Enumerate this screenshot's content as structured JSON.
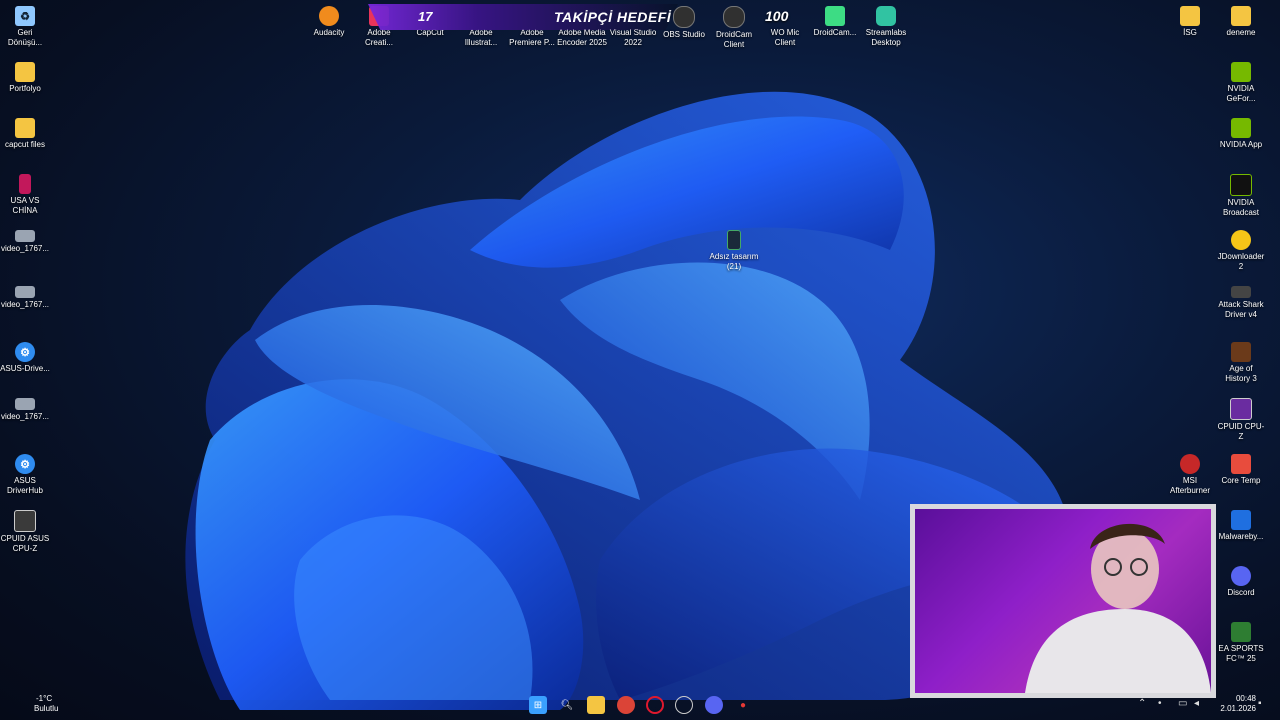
{
  "desktop": {
    "left_icons": [
      {
        "label": "Geri Dönüşü...",
        "icon": "recycle-bin-icon",
        "color": "#8fc8ff"
      },
      {
        "label": "Portfolyo",
        "icon": "folder-icon",
        "color": "#f4c542"
      },
      {
        "label": "capcut files",
        "icon": "folder-icon",
        "color": "#f4c542"
      },
      {
        "label": "USA VS CHİNA",
        "icon": "file-icon",
        "color": "#c2185b"
      },
      {
        "label": "video_1767...",
        "icon": "video-file-icon",
        "color": "#9aa4b2"
      },
      {
        "label": "video_1767...",
        "icon": "video-file-icon",
        "color": "#9aa4b2"
      },
      {
        "label": "ASUS-Drive...",
        "icon": "asus-gear-icon",
        "color": "#2f8cf0"
      },
      {
        "label": "video_1767...",
        "icon": "video-file-icon",
        "color": "#9aa4b2"
      },
      {
        "label": "ASUS DriverHub",
        "icon": "asus-gear-icon",
        "color": "#2f8cf0"
      },
      {
        "label": "CPUID ASUS CPU-Z",
        "icon": "cpuz-icon",
        "color": "#3a3a3a"
      }
    ],
    "top_icons": [
      {
        "label": "Audacity",
        "icon": "audacity-icon",
        "color": "#f08b1d"
      },
      {
        "label": "Adobe Creati...",
        "icon": "creative-cloud-icon",
        "color": "#e8345a"
      },
      {
        "label": "CapCut",
        "icon": "capcut-icon",
        "color": "#222222"
      },
      {
        "label": "Adobe Illustrat...",
        "icon": "illustrator-icon",
        "color": "#ff9a00"
      },
      {
        "label": "Adobe Premiere P...",
        "icon": "premiere-icon",
        "color": "#9999ff"
      },
      {
        "label": "Adobe Media Encoder 2025",
        "icon": "media-encoder-icon",
        "color": "#1e1e3a"
      },
      {
        "label": "Visual Studio 2022",
        "icon": "visual-studio-icon",
        "color": "#8a5cd1"
      },
      {
        "label": "OBS Studio",
        "icon": "obs-icon",
        "color": "#303030"
      },
      {
        "label": "DroidCam Client",
        "icon": "droidcam-icon",
        "color": "#303030"
      },
      {
        "label": "WO Mic Client",
        "icon": "microphone-icon",
        "color": "#c0392b"
      },
      {
        "label": "DroidCam...",
        "icon": "android-icon",
        "color": "#3ddc84"
      },
      {
        "label": "Streamlabs Desktop",
        "icon": "streamlabs-icon",
        "color": "#31c3a2"
      }
    ],
    "right_icons": [
      {
        "label": "İSG",
        "icon": "folder-icon",
        "color": "#f4c542"
      },
      {
        "label": "deneme",
        "icon": "folder-icon",
        "color": "#f4c542"
      },
      {
        "label": "NVIDIA GeFor...",
        "icon": "nvidia-icon",
        "color": "#76b900"
      },
      {
        "label": "NVIDIA App",
        "icon": "nvidia-icon",
        "color": "#76b900"
      },
      {
        "label": "NVIDIA Broadcast",
        "icon": "nvidia-icon",
        "color": "#76b900"
      },
      {
        "label": "JDownloader 2",
        "icon": "jdownloader-icon",
        "color": "#f5c518"
      },
      {
        "label": "Attack Shark Driver v4",
        "icon": "mouse-icon",
        "color": "#444444"
      },
      {
        "label": "Age of History 3",
        "icon": "game-icon",
        "color": "#6b3a1a"
      },
      {
        "label": "CPUID CPU-Z",
        "icon": "cpuz-icon",
        "color": "#6a2ca0"
      },
      {
        "label": "Core Temp",
        "icon": "thermometer-icon",
        "color": "#e84c3d"
      },
      {
        "label": "MSI Afterburner",
        "icon": "afterburner-icon",
        "color": "#c62828"
      },
      {
        "label": "Malwareby...",
        "icon": "malwarebytes-icon",
        "color": "#1f6fe0"
      },
      {
        "label": "Discord",
        "icon": "discord-icon",
        "color": "#5865f2"
      },
      {
        "label": "EA SPORTS FC™ 25",
        "icon": "ea-fc-icon",
        "color": "#2e7d32"
      }
    ],
    "center_icon": {
      "label": "Adsız tasarım (21)",
      "icon": "phone-image-icon",
      "color": "#1a2a3a"
    }
  },
  "overlay": {
    "follower_count": "17",
    "follower_goal_title": "TAKİPÇİ HEDEFİ",
    "secondary_count": "100"
  },
  "taskbar": {
    "weather_temp": "-1°C",
    "weather_desc": "Bulutlu",
    "time": "00:48",
    "date": "2.01.2026",
    "apps": [
      {
        "icon": "windows-start-icon",
        "color": "#3aa0ff"
      },
      {
        "icon": "search-icon",
        "color": "#ffffff"
      },
      {
        "icon": "file-explorer-icon",
        "color": "#f4c542"
      },
      {
        "icon": "chrome-icon",
        "color": "#db4437"
      },
      {
        "icon": "opera-icon",
        "color": "#e0192e"
      },
      {
        "icon": "obs-icon",
        "color": "#cccccc"
      },
      {
        "icon": "discord-icon",
        "color": "#5865f2"
      },
      {
        "icon": "microphone-icon",
        "color": "#e53935"
      }
    ]
  }
}
